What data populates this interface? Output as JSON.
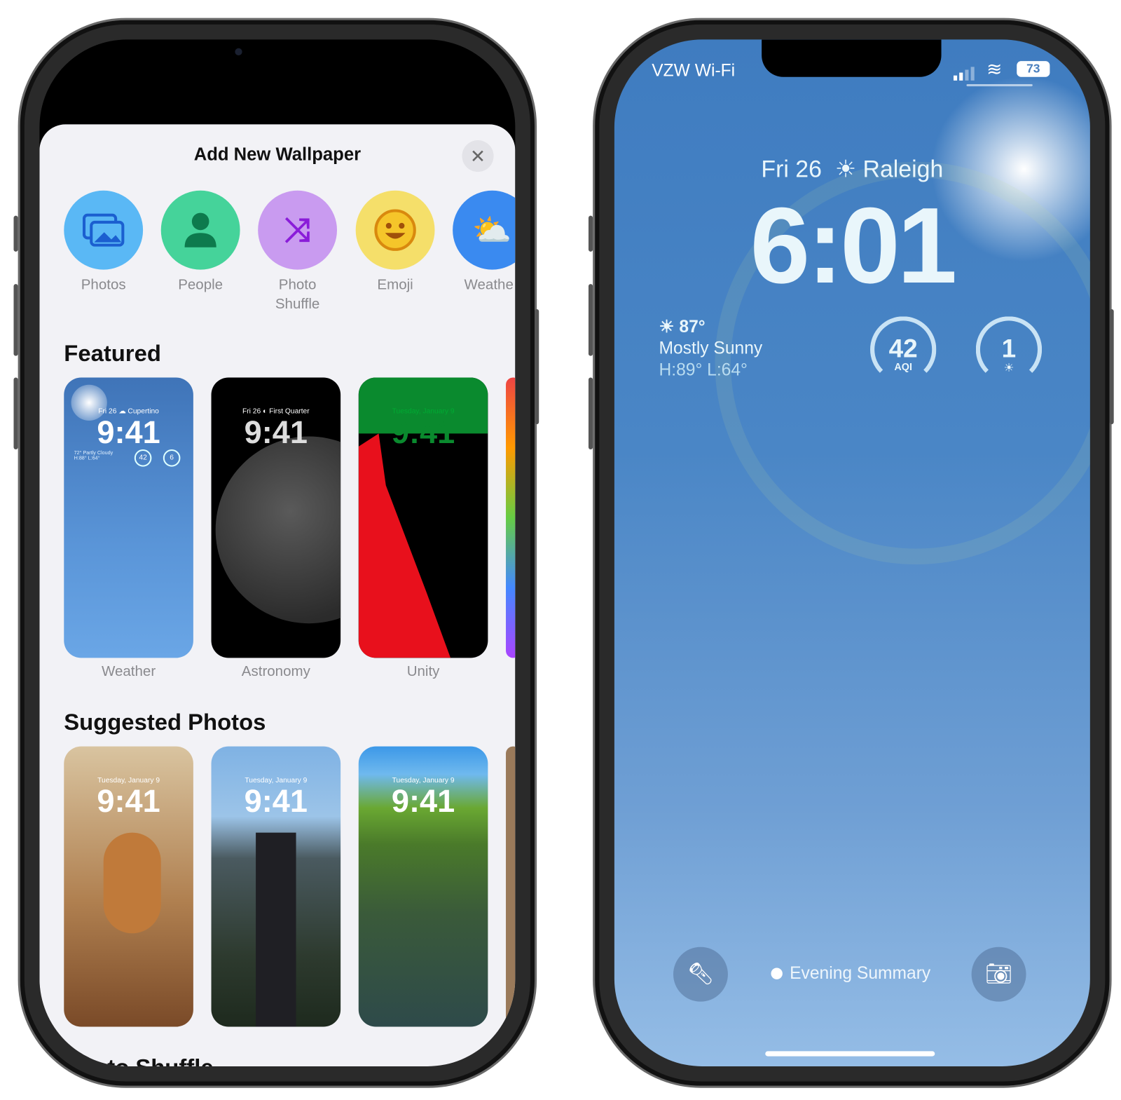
{
  "left_phone": {
    "sheet_title": "Add New Wallpaper",
    "close_icon": "xmark-icon",
    "categories": [
      {
        "label": "Photos",
        "icon": "photos-icon",
        "color": "#5ab8f5"
      },
      {
        "label": "People",
        "icon": "person-icon",
        "color": "#45d39a"
      },
      {
        "label": "Photo Shuffle",
        "icon": "shuffle-icon",
        "color": "#c99bf0"
      },
      {
        "label": "Emoji",
        "icon": "smiley-icon",
        "color": "#f5df6a"
      },
      {
        "label": "Weathe",
        "icon": "cloud-sun-icon",
        "color": "#3a8af0"
      }
    ],
    "featured_title": "Featured",
    "featured": [
      {
        "label": "Weather",
        "date": "Fri 26 ☁ Cupertino",
        "time": "9:41",
        "weather": "72° Partly Cloudy H:88° L:64°",
        "aqi": "42",
        "uv": "6"
      },
      {
        "label": "Astronomy",
        "date": "Fri 26 ◐ First Quarter",
        "time": "9:41"
      },
      {
        "label": "Unity",
        "date": "Tuesday, January 9",
        "time": "9:41"
      }
    ],
    "suggested_title": "Suggested Photos",
    "suggested": [
      {
        "date": "Tuesday, January 9",
        "time": "9:41"
      },
      {
        "date": "Tuesday, January 9",
        "time": "9:41"
      },
      {
        "date": "Tuesday, January 9",
        "time": "9:41"
      }
    ],
    "shuffle_title": "Photo Shuffle"
  },
  "right_phone": {
    "carrier": "VZW Wi-Fi",
    "battery": "73",
    "date_line": "Fri 26",
    "city": "Raleigh",
    "time": "6:01",
    "temp": "87°",
    "condition": "Mostly Sunny",
    "hilo": "H:89° L:64°",
    "aqi_value": "42",
    "aqi_label": "AQI",
    "uv_value": "1",
    "focus": "Evening Summary",
    "flashlight_icon": "flashlight-icon",
    "camera_icon": "camera-icon"
  }
}
